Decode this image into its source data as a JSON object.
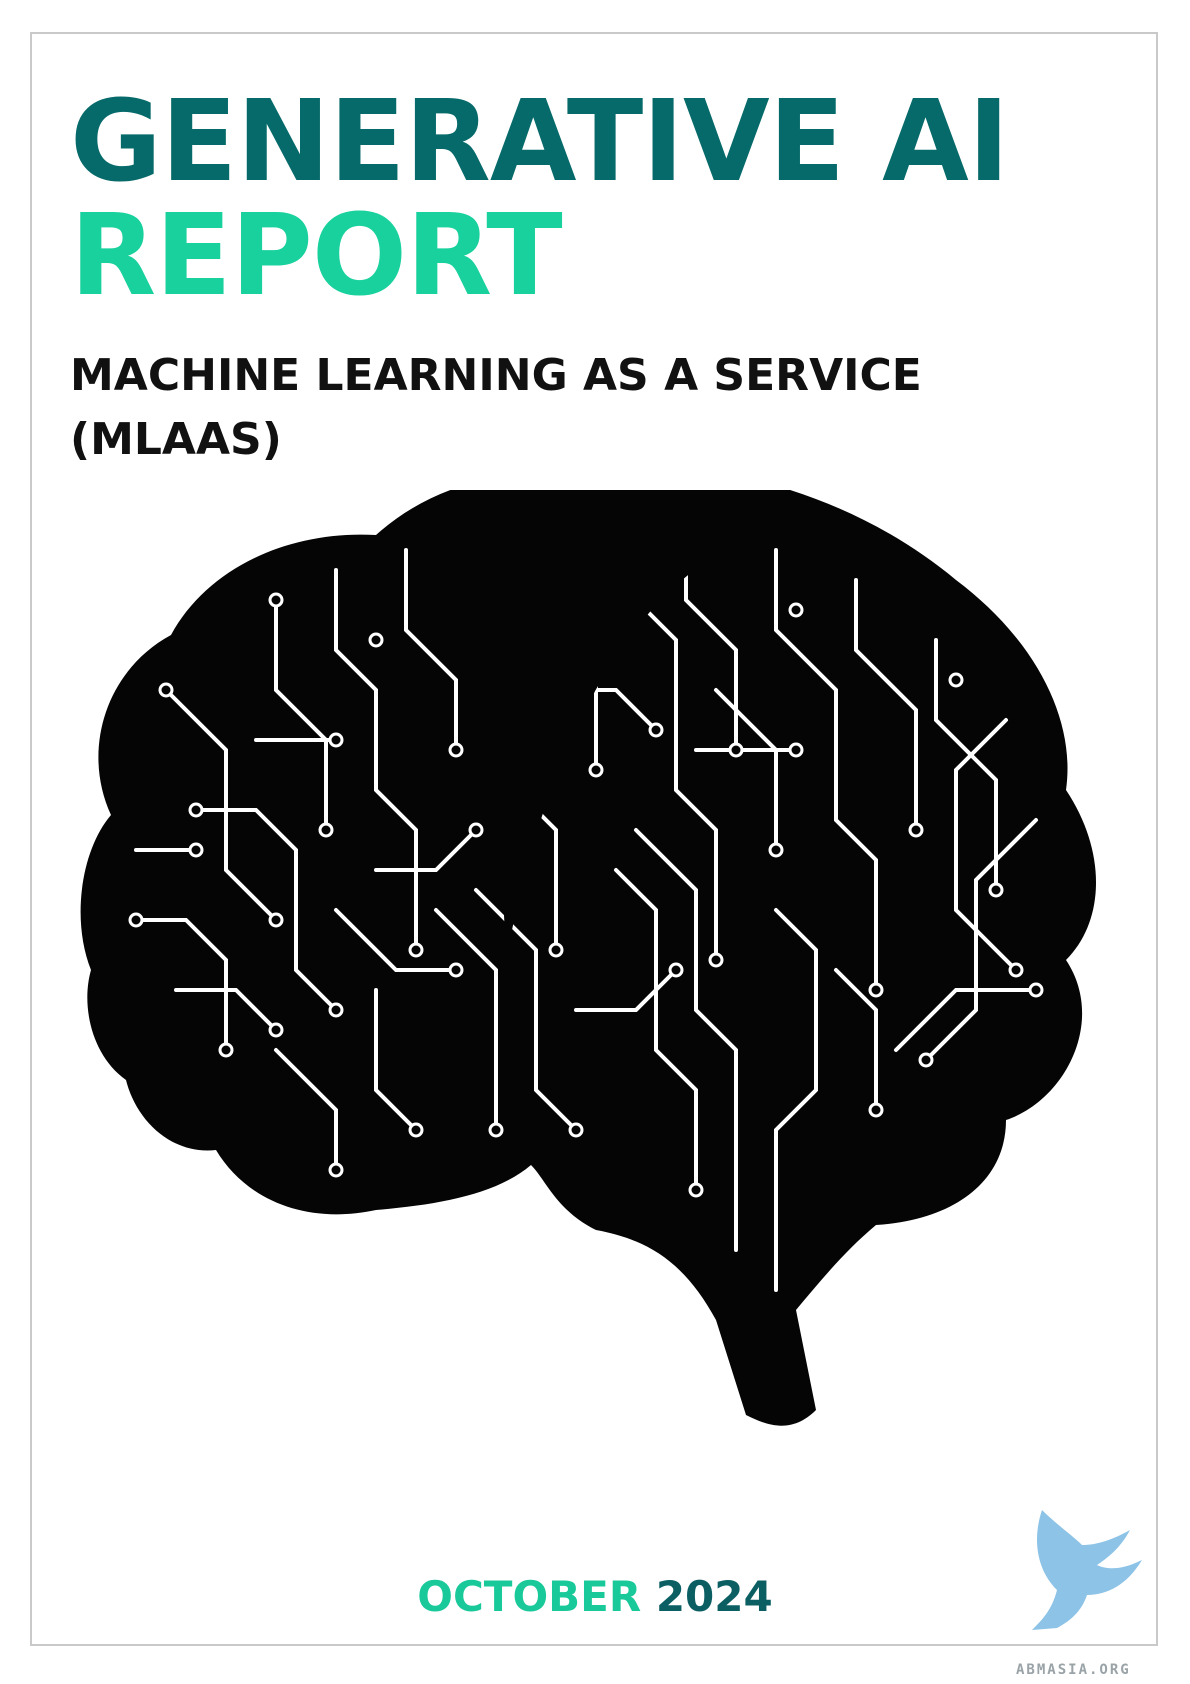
{
  "cover": {
    "title_line1": "GENERATIVE AI",
    "title_line2": "REPORT",
    "subtitle_line1": "MACHINE LEARNING AS A SERVICE",
    "subtitle_line2": "(MLAAS)",
    "date_month": "OCTOBER",
    "date_year": "2024",
    "watermark": "ABMASIA.ORG"
  },
  "colors": {
    "title_dark_teal": "#076a6a",
    "title_green": "#19d19d",
    "month_green": "#19c99a",
    "year_dark_teal": "#0b5f63",
    "brain_fill": "#050505",
    "circuit_trace": "#ffffff",
    "logo_blue": "#8cc3e6"
  },
  "icons": {
    "illustration": "circuit-brain-icon",
    "logo": "griffin-logo-icon"
  }
}
